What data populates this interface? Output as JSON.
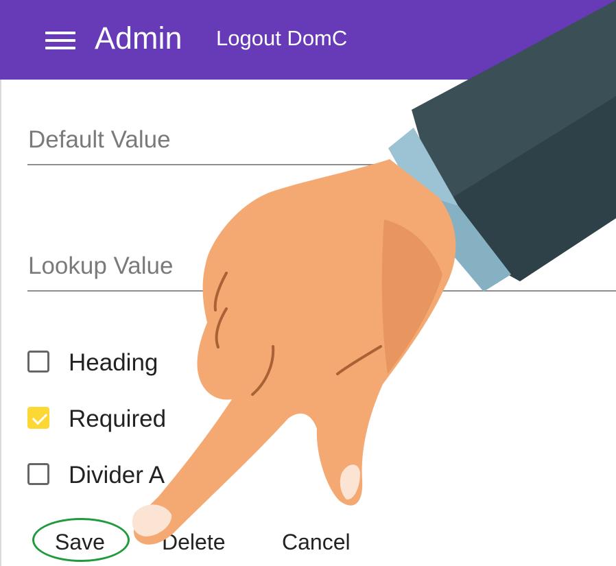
{
  "header": {
    "title": "Admin",
    "logout_label": "Logout DomC",
    "menu_icon": "hamburger-menu-icon",
    "background_color": "#673ab7"
  },
  "form": {
    "default_value_label": "Default Value",
    "lookup_value_label": "Lookup Value",
    "checkboxes": [
      {
        "label": "Heading",
        "checked": false
      },
      {
        "label": "Required",
        "checked": true
      },
      {
        "label": "Divider A",
        "checked": false
      }
    ],
    "checked_color": "#fdd835"
  },
  "actions": {
    "save_label": "Save",
    "delete_label": "Delete",
    "cancel_label": "Cancel",
    "highlight_color": "#1f9a3c"
  },
  "overlay": {
    "illustration": "pointing-hand-illustration",
    "skin_color": "#f4a972",
    "sleeve_color": "#3b4f56",
    "cuff_color": "#9cc3d3"
  }
}
